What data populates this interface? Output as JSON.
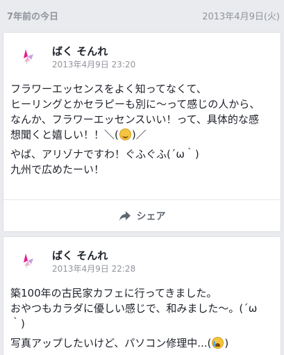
{
  "memory": {
    "title": "7年前の今日",
    "date": "2013年4月9日(火)"
  },
  "posts": [
    {
      "author": "ばく そんれ",
      "timestamp": "2013年4月9日 23:20",
      "paragraphs": [
        [
          "フラワーエッセンスをよく知ってなくて、",
          "ヒーリングとかセラピーも別に〜って感じの人から、",
          "なんか、フラワーエッセンスいい！って、具体的な感",
          "想聞くと嬉しい！！＼(",
          ")／"
        ],
        [
          "やば、アリゾナですわ！ぐふぐふ(´ω｀)",
          "九州で広めたーい！"
        ]
      ],
      "emoji": "smiling-face",
      "share_label": "シェア"
    },
    {
      "author": "ばく そんれ",
      "timestamp": "2013年4月9日 22:28",
      "paragraphs": [
        [
          "築100年の古民家カフェに行ってきました。",
          "おやつもカラダに優しい感じで、和みました〜。(´ω",
          "｀)"
        ],
        [
          "写真アップしたいけど、パソコン修理中...("
        ]
      ],
      "emoji": "crying-face",
      "closing_paren": ")"
    }
  ],
  "colors": {
    "background": "#e9ebee",
    "card": "#ffffff",
    "text": "#1d2129",
    "muted": "#90949c",
    "avatar_accent": "#e6007e"
  }
}
